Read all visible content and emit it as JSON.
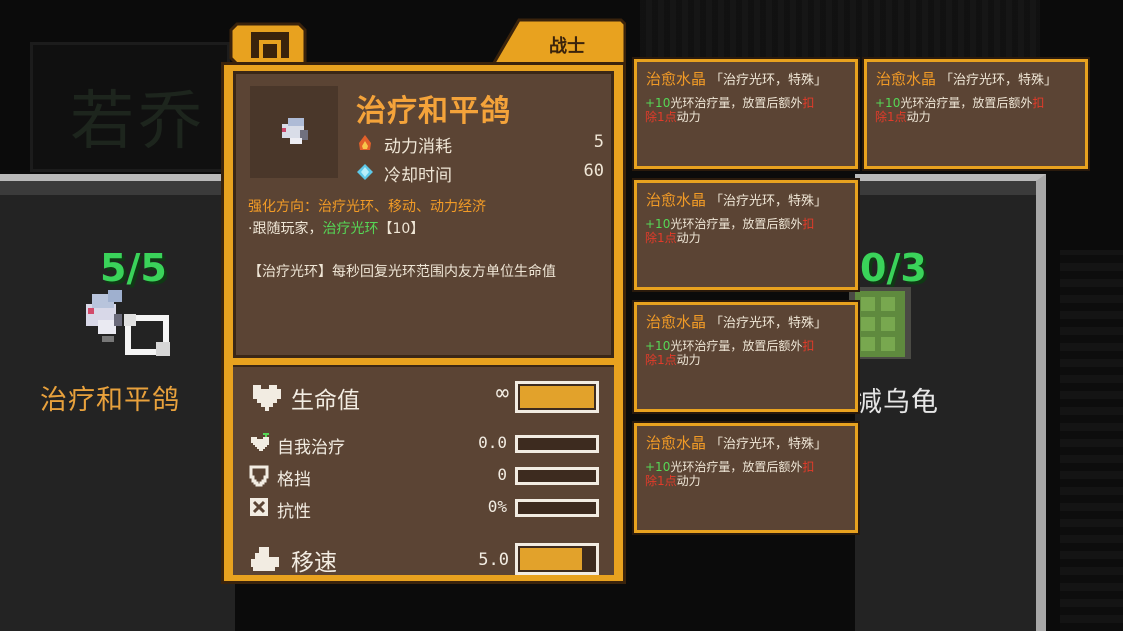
{
  "scene": {
    "left_unit": {
      "count": "5/5",
      "name": "治疗和平鸽"
    },
    "right_unit": {
      "count": "0/3",
      "name": "减乌龟"
    },
    "faint_bg_text": "若乔"
  },
  "tooltip": {
    "class_label": "战士",
    "title": "治疗和平鸽",
    "energy_cost_label": "动力消耗",
    "energy_cost_value": "5",
    "cooldown_label": "冷却时间",
    "cooldown_value": "60",
    "upgrade_line": "强化方向：治疗光环、移动、动力经济",
    "follow_prefix": "·跟随玩家，",
    "follow_green": "治疗光环",
    "follow_suffix": "【10】",
    "description": "【治疗光环】每秒回复光环范围内友方单位生命值",
    "attributes": {
      "hp": {
        "label": "生命值",
        "value": "∞",
        "fill": 1.0
      },
      "self_heal": {
        "label": "自我治疗",
        "value": "0.0",
        "fill": 0.0
      },
      "block": {
        "label": "格挡",
        "value": "0",
        "fill": 0.0
      },
      "resist": {
        "label": "抗性",
        "value": "0%",
        "fill": 0.0
      },
      "speed": {
        "label": "移速",
        "value": "5.0",
        "fill": 0.85
      }
    },
    "colors": {
      "frame": "#e8a21f",
      "panel": "#5b4434",
      "title": "#f4a33a",
      "green": "#56d756"
    }
  },
  "crystal_cards": [
    {
      "name": "治愈水晶",
      "tag": "「治疗光环，特殊」",
      "plus": "+10",
      "text_a": "光环治疗量，放置后额外",
      "red": "扣",
      "text_b_red": "除1点",
      "text_b": "动力"
    },
    {
      "name": "治愈水晶",
      "tag": "「治疗光环，特殊」",
      "plus": "+10",
      "text_a": "光环治疗量，放置后额外",
      "red": "扣",
      "text_b_red": "除1点",
      "text_b": "动力"
    },
    {
      "name": "治愈水晶",
      "tag": "「治疗光环，特殊」",
      "plus": "+10",
      "text_a": "光环治疗量，放置后额外",
      "red": "扣",
      "text_b_red": "除1点",
      "text_b": "动力"
    },
    {
      "name": "治愈水晶",
      "tag": "「治疗光环，特殊」",
      "plus": "+10",
      "text_a": "光环治疗量，放置后额外",
      "red": "扣",
      "text_b_red": "除1点",
      "text_b": "动力"
    },
    {
      "name": "治愈水晶",
      "tag": "「治疗光环，特殊」",
      "plus": "+10",
      "text_a": "光环治疗量，放置后额外",
      "red": "扣",
      "text_b_red": "除1点",
      "text_b": "动力"
    }
  ]
}
